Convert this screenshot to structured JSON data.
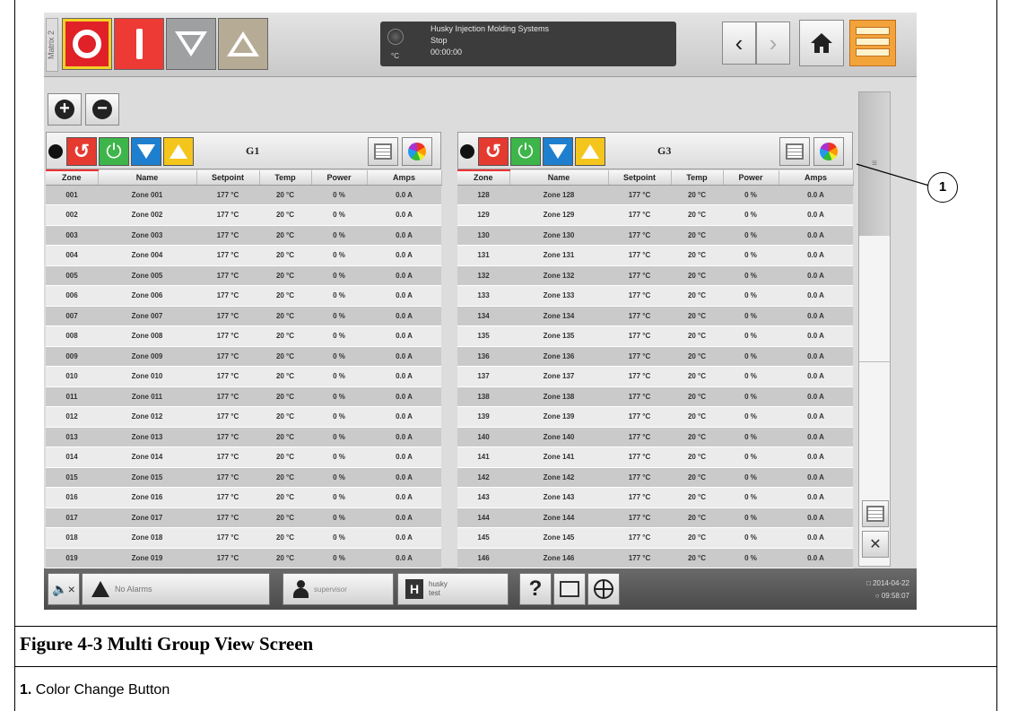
{
  "topbar": {
    "matrix_label": "Matrix 2",
    "status_unit": "°C",
    "status_lines": [
      "Husky Injection Molding Systems",
      "Stop",
      "00:00:00"
    ]
  },
  "groups": [
    {
      "name": "G1",
      "columns": [
        "Zone",
        "Name",
        "Setpoint",
        "Temp",
        "Power",
        "Amps"
      ],
      "rows": [
        [
          "001",
          "Zone 001",
          "177 °C",
          "20 °C",
          "0 %",
          "0.0 A"
        ],
        [
          "002",
          "Zone 002",
          "177 °C",
          "20 °C",
          "0 %",
          "0.0 A"
        ],
        [
          "003",
          "Zone 003",
          "177 °C",
          "20 °C",
          "0 %",
          "0.0 A"
        ],
        [
          "004",
          "Zone 004",
          "177 °C",
          "20 °C",
          "0 %",
          "0.0 A"
        ],
        [
          "005",
          "Zone 005",
          "177 °C",
          "20 °C",
          "0 %",
          "0.0 A"
        ],
        [
          "006",
          "Zone 006",
          "177 °C",
          "20 °C",
          "0 %",
          "0.0 A"
        ],
        [
          "007",
          "Zone 007",
          "177 °C",
          "20 °C",
          "0 %",
          "0.0 A"
        ],
        [
          "008",
          "Zone 008",
          "177 °C",
          "20 °C",
          "0 %",
          "0.0 A"
        ],
        [
          "009",
          "Zone 009",
          "177 °C",
          "20 °C",
          "0 %",
          "0.0 A"
        ],
        [
          "010",
          "Zone 010",
          "177 °C",
          "20 °C",
          "0 %",
          "0.0 A"
        ],
        [
          "011",
          "Zone 011",
          "177 °C",
          "20 °C",
          "0 %",
          "0.0 A"
        ],
        [
          "012",
          "Zone 012",
          "177 °C",
          "20 °C",
          "0 %",
          "0.0 A"
        ],
        [
          "013",
          "Zone 013",
          "177 °C",
          "20 °C",
          "0 %",
          "0.0 A"
        ],
        [
          "014",
          "Zone 014",
          "177 °C",
          "20 °C",
          "0 %",
          "0.0 A"
        ],
        [
          "015",
          "Zone 015",
          "177 °C",
          "20 °C",
          "0 %",
          "0.0 A"
        ],
        [
          "016",
          "Zone 016",
          "177 °C",
          "20 °C",
          "0 %",
          "0.0 A"
        ],
        [
          "017",
          "Zone 017",
          "177 °C",
          "20 °C",
          "0 %",
          "0.0 A"
        ],
        [
          "018",
          "Zone 018",
          "177 °C",
          "20 °C",
          "0 %",
          "0.0 A"
        ],
        [
          "019",
          "Zone 019",
          "177 °C",
          "20 °C",
          "0 %",
          "0.0 A"
        ]
      ]
    },
    {
      "name": "G3",
      "columns": [
        "Zone",
        "Name",
        "Setpoint",
        "Temp",
        "Power",
        "Amps"
      ],
      "rows": [
        [
          "128",
          "Zone 128",
          "177 °C",
          "20 °C",
          "0 %",
          "0.0 A"
        ],
        [
          "129",
          "Zone 129",
          "177 °C",
          "20 °C",
          "0 %",
          "0.0 A"
        ],
        [
          "130",
          "Zone 130",
          "177 °C",
          "20 °C",
          "0 %",
          "0.0 A"
        ],
        [
          "131",
          "Zone 131",
          "177 °C",
          "20 °C",
          "0 %",
          "0.0 A"
        ],
        [
          "132",
          "Zone 132",
          "177 °C",
          "20 °C",
          "0 %",
          "0.0 A"
        ],
        [
          "133",
          "Zone 133",
          "177 °C",
          "20 °C",
          "0 %",
          "0.0 A"
        ],
        [
          "134",
          "Zone 134",
          "177 °C",
          "20 °C",
          "0 %",
          "0.0 A"
        ],
        [
          "135",
          "Zone 135",
          "177 °C",
          "20 °C",
          "0 %",
          "0.0 A"
        ],
        [
          "136",
          "Zone 136",
          "177 °C",
          "20 °C",
          "0 %",
          "0.0 A"
        ],
        [
          "137",
          "Zone 137",
          "177 °C",
          "20 °C",
          "0 %",
          "0.0 A"
        ],
        [
          "138",
          "Zone 138",
          "177 °C",
          "20 °C",
          "0 %",
          "0.0 A"
        ],
        [
          "139",
          "Zone 139",
          "177 °C",
          "20 °C",
          "0 %",
          "0.0 A"
        ],
        [
          "140",
          "Zone 140",
          "177 °C",
          "20 °C",
          "0 %",
          "0.0 A"
        ],
        [
          "141",
          "Zone 141",
          "177 °C",
          "20 °C",
          "0 %",
          "0.0 A"
        ],
        [
          "142",
          "Zone 142",
          "177 °C",
          "20 °C",
          "0 %",
          "0.0 A"
        ],
        [
          "143",
          "Zone 143",
          "177 °C",
          "20 °C",
          "0 %",
          "0.0 A"
        ],
        [
          "144",
          "Zone 144",
          "177 °C",
          "20 °C",
          "0 %",
          "0.0 A"
        ],
        [
          "145",
          "Zone 145",
          "177 °C",
          "20 °C",
          "0 %",
          "0.0 A"
        ],
        [
          "146",
          "Zone 146",
          "177 °C",
          "20 °C",
          "0 %",
          "0.0 A"
        ]
      ]
    }
  ],
  "bottombar": {
    "alarms": "No Alarms",
    "user": "supervisor",
    "mold_name": "husky",
    "mold_sub": "test",
    "help": "?",
    "date": "2014-04-22",
    "time": "09:58:07"
  },
  "callout": {
    "number": "1"
  },
  "caption": {
    "figure": "Figure 4-3   Multi Group View Screen",
    "legend_num": "1.",
    "legend_text": " Color Change Button"
  },
  "colors": {
    "stop": "#e02127",
    "start": "#ee3a35",
    "heat_on": "#3db54a",
    "heat_off": "#e53a30",
    "boost": "#f4c51c",
    "standby": "#1f7fcf",
    "menu": "#f2a33a"
  },
  "icons": [
    "stop-icon",
    "start-icon",
    "standby-icon",
    "boost-icon",
    "back-icon",
    "forward-icon",
    "home-icon",
    "menu-icon",
    "zoom-in-icon",
    "zoom-out-icon",
    "color-wheel-icon",
    "grid-icon",
    "mute-icon",
    "warning-icon",
    "user-icon",
    "mold-icon",
    "help-icon",
    "screenshot-icon",
    "globe-icon"
  ]
}
